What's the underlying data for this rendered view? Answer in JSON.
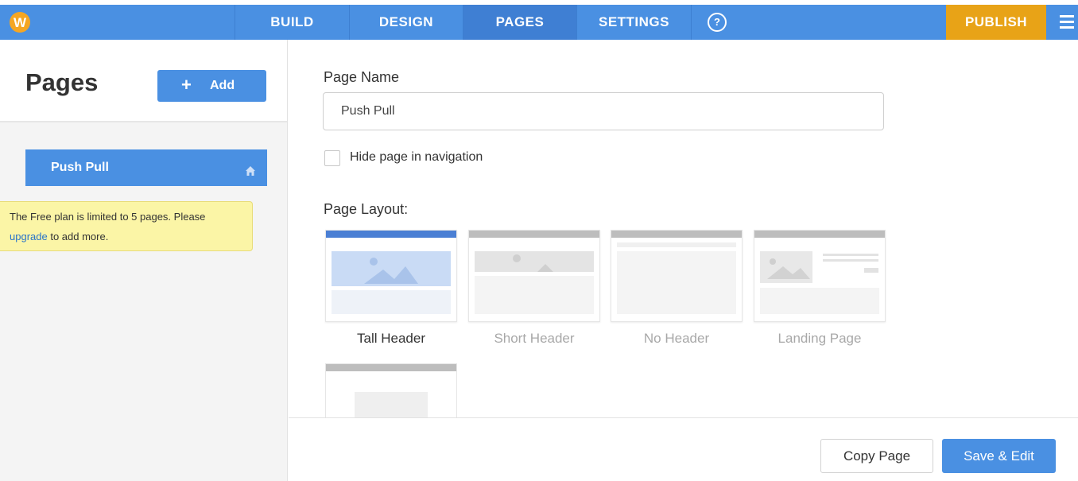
{
  "topbar": {
    "logo_letter": "W",
    "nav": [
      "BUILD",
      "DESIGN",
      "PAGES",
      "SETTINGS"
    ],
    "help_label": "?",
    "publish_label": "PUBLISH",
    "active": "PAGES",
    "colors": {
      "bar": "#4a90e2",
      "publish": "#e8a317"
    }
  },
  "sidebar": {
    "title": "Pages",
    "add_label": "Add",
    "pages": [
      {
        "label": "Push Pull",
        "is_home": true,
        "selected": true
      }
    ],
    "notice": {
      "text_before": "The Free plan is limited to 5 pages. Please",
      "link": "upgrade",
      "text_after": "to add more."
    }
  },
  "main": {
    "page_name_label": "Page Name",
    "page_name_value": "Push Pull",
    "hide_nav_label": "Hide page in navigation",
    "hide_nav_checked": false,
    "layout_label": "Page Layout:",
    "layouts": [
      {
        "label": "Tall Header",
        "selected": true
      },
      {
        "label": "Short Header",
        "selected": false
      },
      {
        "label": "No Header",
        "selected": false
      },
      {
        "label": "Landing Page",
        "selected": false
      }
    ]
  },
  "footer": {
    "copy_label": "Copy Page",
    "save_label": "Save & Edit"
  }
}
